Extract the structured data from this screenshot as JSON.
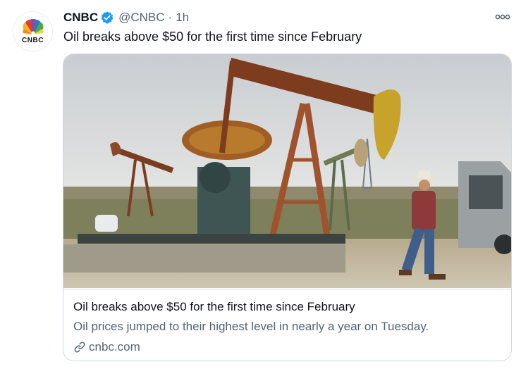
{
  "tweet": {
    "author_name": "CNBC",
    "handle": "@CNBC",
    "separator": "·",
    "time": "1h",
    "text": "Oil breaks above $50 for the first time since February",
    "avatar_logo_text": "CNBC",
    "verified": true
  },
  "card": {
    "title": "Oil breaks above $50 for the first time since February",
    "description": "Oil prices jumped to their highest level in nearly a year on Tuesday.",
    "domain": "cnbc.com"
  },
  "colors": {
    "verified_blue": "#1d9bf0",
    "secondary_text": "#536471",
    "primary_text": "#0f1419",
    "border": "#cfd9de"
  },
  "icons": {
    "verified": "verified-badge-icon",
    "more": "more-horizontal-icon",
    "link": "link-icon"
  }
}
